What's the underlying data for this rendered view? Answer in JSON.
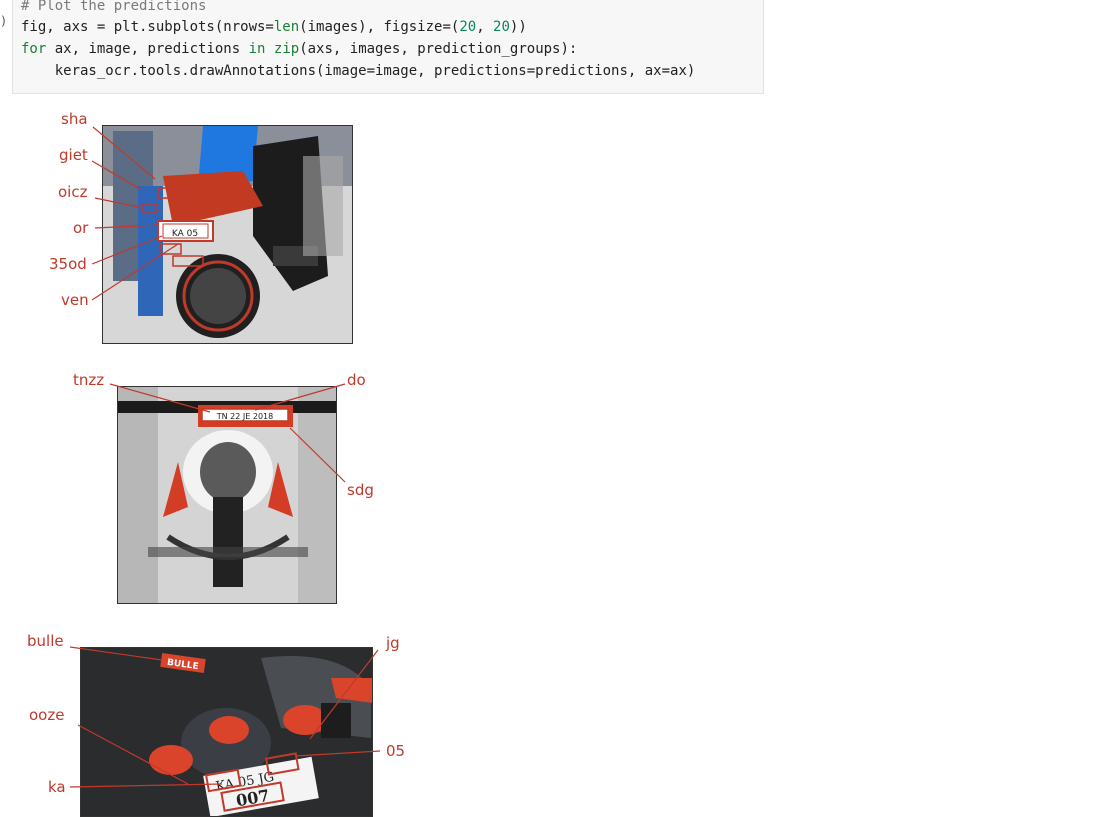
{
  "code_cell": {
    "prompt_mark": ")",
    "lines": {
      "comment": "# Plot the predictions",
      "l2_a": "fig, axs = plt.subplots(nrows=",
      "l2_len": "len",
      "l2_b": "(images), figsize=(",
      "l2_n1": "20",
      "l2_c": ", ",
      "l2_n2": "20",
      "l2_d": "))",
      "l3_for": "for",
      "l3_a": " ax, image, predictions ",
      "l3_in": "in",
      "l3_b": " ",
      "l3_zip": "zip",
      "l3_c": "(axs, images, prediction_groups):",
      "l4": "    keras_ocr.tools.drawAnnotations(image=image, predictions=predictions, ax=ax)"
    }
  },
  "annotations": {
    "color": "#c0392b",
    "panel1": [
      "sha",
      "giet",
      "oicz",
      "or",
      "35od",
      "ven"
    ],
    "panel2": [
      "tnzz",
      "do",
      "sdg"
    ],
    "panel3": [
      "bulle",
      "jg",
      "ooze",
      "05",
      "ka"
    ]
  },
  "plates": {
    "panel1": "KA 05",
    "panel2": "TN 22 JE 2018",
    "panel3_tag": "BULLE",
    "panel3_top": "KA 05 JG",
    "panel3_bottom": "007"
  }
}
